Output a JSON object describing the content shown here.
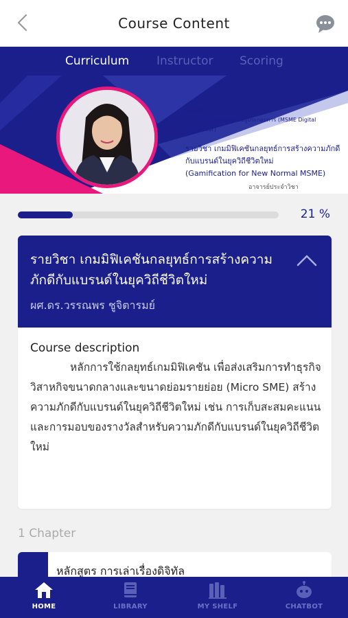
{
  "header": {
    "title": "Course Content",
    "back_icon": "chevron-left-icon",
    "chat_icon": "chat-bubble-icon"
  },
  "tabs": [
    {
      "label": "Curriculum",
      "active": true
    },
    {
      "label": "Instructor",
      "active": false
    },
    {
      "label": "Scoring",
      "active": false
    }
  ],
  "banner": {
    "line1": "หลักสูตร",
    "line2": "การเล่าเรื่องดิจิทัลสำหรับผู้ประกอบการ (MSME Digital",
    "line3": "Storyteller)",
    "main1": "รายวิชา เกมมิฟิเคชันกลยุทธ์การสร้างความภักดี",
    "main2": "กับแบรนด์ในยุควิถีชีวิตใหม่",
    "main3": "(Gamification for New Normal MSME)",
    "signature": "อาจารย์ประจำวิชา"
  },
  "progress": {
    "percent": 21,
    "label": "21 %"
  },
  "course": {
    "title": "รายวิชา เกมมิฟิเคชันกลยุทธ์การสร้างความภักดีกับแบรนด์ในยุควิถีชีวิตใหม่",
    "author": "ผศ.ดร.วรรณพร ชูจิตารมย์",
    "description_label": "Course description",
    "description": "หลักการใช้กลยุทธ์เกมมิฟิเคชัน เพื่อส่งเสริมการทำธุรกิจวิสาหกิจขนาดกลางและขนาดย่อมรายย่อย (Micro SME) สร้างความภักดีกับแบรนด์ในยุควิถีชีวิตใหม่ เช่น การเก็บสะสมคะแนน และการมอบของรางวัลสำหรับความภักดีกับแบรนด์ในยุควิถีชีวิตใหม่"
  },
  "chapters": {
    "count_label": "1 Chapter",
    "items": [
      {
        "title": "หลักสูตร การเล่าเรื่องดิจิทัล"
      }
    ]
  },
  "bottom_nav": [
    {
      "label": "HOME",
      "icon": "home-icon",
      "active": true
    },
    {
      "label": "LIBRARY",
      "icon": "book-icon",
      "active": false
    },
    {
      "label": "MY SHELF",
      "icon": "shelf-icon",
      "active": false
    },
    {
      "label": "CHATBOT",
      "icon": "robot-icon",
      "active": false
    }
  ],
  "colors": {
    "primary": "#1a1f8c",
    "accent": "#e8187c"
  }
}
